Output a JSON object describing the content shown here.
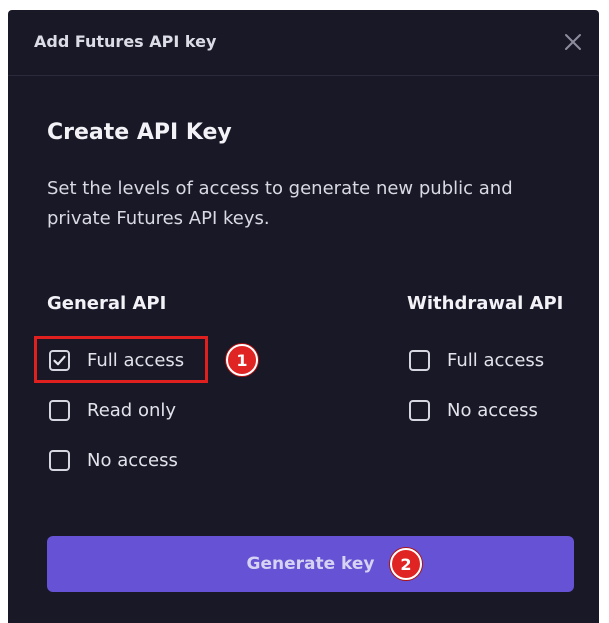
{
  "header": {
    "title": "Add Futures API key",
    "close_icon": "close-icon"
  },
  "main": {
    "title": "Create API Key",
    "description": "Set the levels of access to generate new public and private Futures API keys."
  },
  "general_api": {
    "title": "General API",
    "options": [
      {
        "label": "Full access",
        "checked": true
      },
      {
        "label": "Read only",
        "checked": false
      },
      {
        "label": "No access",
        "checked": false
      }
    ]
  },
  "withdrawal_api": {
    "title": "Withdrawal API",
    "options": [
      {
        "label": "Full access",
        "checked": false
      },
      {
        "label": "No access",
        "checked": false
      }
    ]
  },
  "annotations": {
    "marker_1": "1",
    "marker_2": "2",
    "highlight_color": "#e01f1f"
  },
  "footer": {
    "generate_label": "Generate key"
  },
  "colors": {
    "background": "#191827",
    "accent": "#6652d4",
    "annotation_red": "#e02424"
  }
}
